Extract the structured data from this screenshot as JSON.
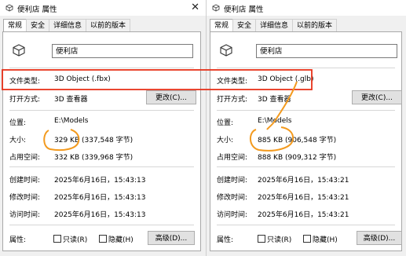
{
  "left": {
    "title": "便利店 属性",
    "tabs": [
      "常规",
      "安全",
      "详细信息",
      "以前的版本"
    ],
    "name": "便利店",
    "type_label": "文件类型:",
    "type_value": "3D Object (.fbx)",
    "open_label": "打开方式:",
    "open_value": "3D 查看器",
    "change_button": "更改(C)...",
    "location_label": "位置:",
    "location_value": "E:\\Models",
    "size_label": "大小:",
    "size_value": "329 KB (337,548 字节)",
    "disk_label": "占用空间:",
    "disk_value": "332 KB (339,968 字节)",
    "created_label": "创建时间:",
    "created_value": "2025年6月16日，15:43:13",
    "modified_label": "修改时间:",
    "modified_value": "2025年6月16日，15:43:13",
    "accessed_label": "访问时间:",
    "accessed_value": "2025年6月16日，15:43:13",
    "attr_label": "属性:",
    "readonly_label": "只读(R)",
    "hidden_label": "隐藏(H)",
    "advanced_button": "高级(D)..."
  },
  "right": {
    "title": "便利店 属性",
    "tabs": [
      "常规",
      "安全",
      "详细信息",
      "以前的版本"
    ],
    "name": "便利店",
    "type_label": "文件类型:",
    "type_value": "3D Object (.glb)",
    "open_label": "打开方式:",
    "open_value": "3D 查看器",
    "change_button": "更改(C)...",
    "location_label": "位置:",
    "location_value": "E:\\Models",
    "size_label": "大小:",
    "size_value": "885 KB (906,548 字节)",
    "disk_label": "占用空间:",
    "disk_value": "888 KB (909,312 字节)",
    "created_label": "创建时间:",
    "created_value": "2025年6月16日，15:43:21",
    "modified_label": "修改时间:",
    "modified_value": "2025年6月16日，15:43:21",
    "accessed_label": "访问时间:",
    "accessed_value": "2025年6月16日，15:43:21",
    "attr_label": "属性:",
    "readonly_label": "只读(R)",
    "hidden_label": "隐藏(H)",
    "advanced_button": "高级(D)..."
  },
  "colors": {
    "annotation": "#e8311a",
    "annotation_orange": "#f39a1e"
  }
}
